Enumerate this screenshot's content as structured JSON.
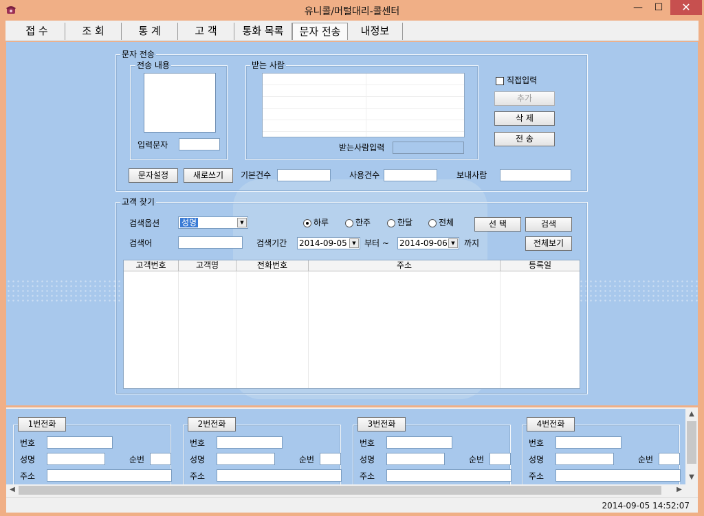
{
  "window": {
    "title": "유니콜/머털대리-콜센터",
    "min_glyph": "—",
    "max_glyph": "☐",
    "close_glyph": "✕",
    "icon": "telephone-icon"
  },
  "tabs": [
    {
      "label": "접 수"
    },
    {
      "label": "조 회"
    },
    {
      "label": "통 계"
    },
    {
      "label": "고 객"
    },
    {
      "label": "통화 목록"
    },
    {
      "label": "문자 전송",
      "active": true
    },
    {
      "label": "내정보"
    }
  ],
  "sms": {
    "legend": "문자 전송",
    "content_legend": "전송 내용",
    "input_chars_label": "입력문자",
    "input_chars_value": "",
    "recipients_legend": "받는 사람",
    "recipient_input_label": "받는사람입력",
    "recipient_input_value": "",
    "direct_input_label": "직접입력",
    "direct_input_checked": false,
    "add_button": "추가",
    "delete_button": "삭 제",
    "send_button": "전 송",
    "msg_settings_button": "문자설정",
    "new_write_button": "새로쓰기",
    "basic_count_label": "기본건수",
    "basic_count_value": "",
    "used_count_label": "사용건수",
    "used_count_value": "",
    "sender_label": "보내사람",
    "sender_value": ""
  },
  "search": {
    "legend": "고객 찾기",
    "option_label": "검색옵션",
    "option_value": "성명",
    "keyword_label": "검색어",
    "keyword_value": "",
    "period_label": "검색기간",
    "date_from": "2014-09-05",
    "from_suffix": "부터 ~",
    "date_to": "2014-09-06",
    "to_suffix": "까지",
    "radios": [
      {
        "label": "하루",
        "checked": true
      },
      {
        "label": "한주",
        "checked": false
      },
      {
        "label": "한달",
        "checked": false
      },
      {
        "label": "전체",
        "checked": false
      }
    ],
    "select_button": "선 택",
    "search_button": "검색",
    "view_all_button": "전체보기",
    "columns": [
      "고객번호",
      "고객명",
      "전화번호",
      "주소",
      "등록일"
    ]
  },
  "phones": [
    {
      "title": "1번전화",
      "no_label": "번호",
      "name_label": "성명",
      "seq_label": "순번",
      "addr_label": "주소"
    },
    {
      "title": "2번전화",
      "no_label": "번호",
      "name_label": "성명",
      "seq_label": "순번",
      "addr_label": "주소"
    },
    {
      "title": "3번전화",
      "no_label": "번호",
      "name_label": "성명",
      "seq_label": "순번",
      "addr_label": "주소"
    },
    {
      "title": "4번전화",
      "no_label": "번호",
      "name_label": "성명",
      "seq_label": "순번",
      "addr_label": "주소"
    }
  ],
  "scroll_arrows": {
    "up": "▲",
    "down": "▼",
    "left": "◀",
    "right": "▶"
  },
  "status": {
    "datetime": "2014-09-05  14:52:07"
  }
}
